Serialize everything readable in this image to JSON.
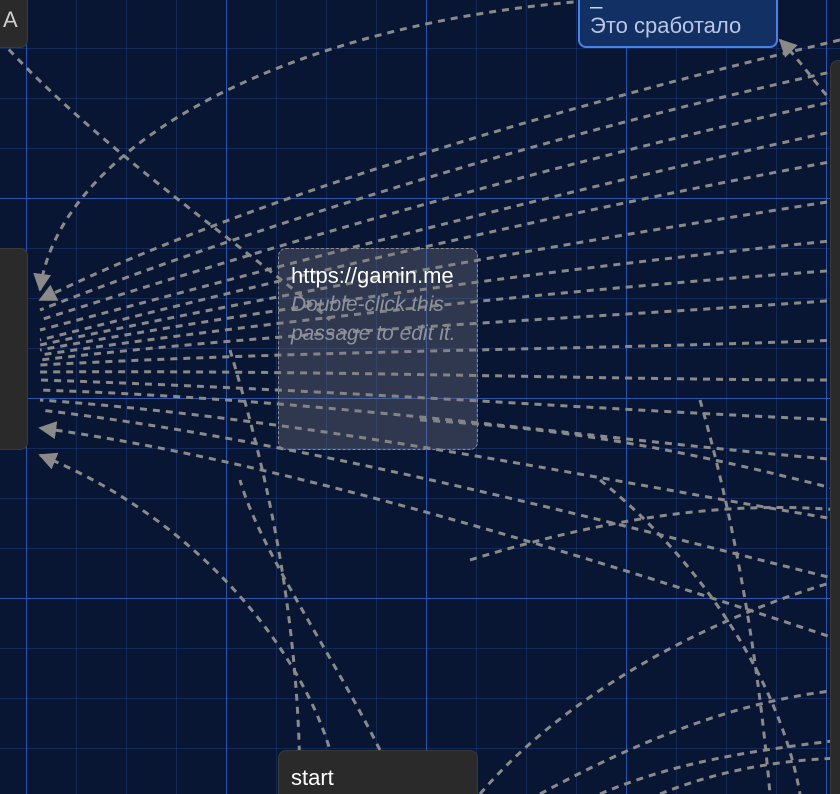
{
  "passages": {
    "top_left": {
      "title": "A"
    },
    "top_right": {
      "title": "_ ",
      "excerpt": "Это сработало"
    },
    "center": {
      "title": "https://gamin.me",
      "excerpt": "Double-click this passage to edit it."
    },
    "start": {
      "title": "start"
    }
  },
  "colors": {
    "canvas": "#081633",
    "grid_major": "#3264c8",
    "passage": "#2a2a2a",
    "selected_passage": "#123063",
    "selected_border": "#4a82e6",
    "link": "#8a8a8a"
  }
}
